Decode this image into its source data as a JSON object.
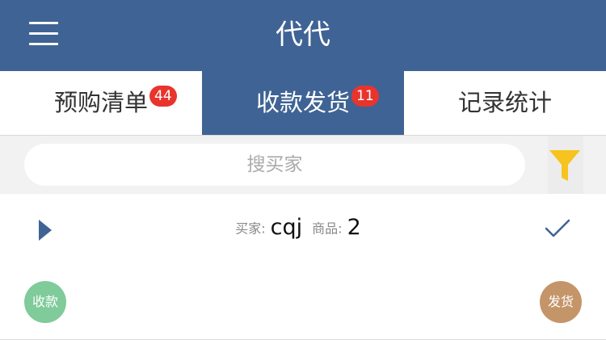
{
  "header": {
    "title": "代代",
    "menu_icon": "hamburger-menu-icon"
  },
  "tabs": [
    {
      "label": "预购清单",
      "badge": "44",
      "active": false
    },
    {
      "label": "收款发货",
      "badge": "11",
      "active": true
    },
    {
      "label": "记录统计",
      "badge": "",
      "active": false
    }
  ],
  "search": {
    "placeholder": "搜买家",
    "filter_icon": "funnel-filter-icon"
  },
  "order": {
    "buyer_label": "买家:",
    "buyer_value": "cqj",
    "goods_label": "商品:",
    "goods_value": "2",
    "expand_icon": "triangle-right-icon",
    "check_icon": "checkmark-icon",
    "pay_label": "收款",
    "ship_label": "发货"
  },
  "colors": {
    "primary": "#3f6394",
    "badge": "#e8342c",
    "filter": "#f7c31e",
    "pay": "#7fcb9a",
    "ship": "#c5956a"
  }
}
